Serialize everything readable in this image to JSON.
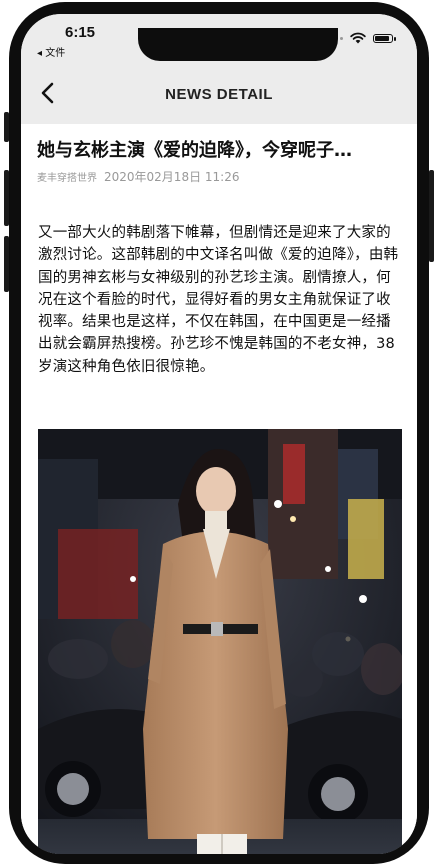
{
  "status_bar": {
    "time": "6:15",
    "back_app": "◂ 文件",
    "signal_icon": "signal-dots-icon",
    "wifi_icon": "wifi-icon",
    "battery_icon": "battery-icon",
    "battery_level": 0.85
  },
  "nav": {
    "title": "NEWS DETAIL",
    "back_icon": "chevron-left-icon"
  },
  "article": {
    "title": "她与玄彬主演《爱的迫降》，今穿呢子…",
    "source": "麦丰穿搭世界",
    "date": "2020年02月18日 11:26",
    "body": "又一部大火的韩剧落下帷幕，但剧情还是迎来了大家的激烈讨论。这部韩剧的中文译名叫做《爱的迫降》，由韩国的男神玄彬与女神级别的孙艺珍主演。剧情撩人，何况在这个看脸的时代，显得好看的男女主角就保证了收视率。结果也是这样，不仅在韩国，在中国更是一经播出就会霸屏热搜榜。孙艺珍不愧是韩国的不老女神，38岁演这种角色依旧很惊艳。"
  },
  "colors": {
    "header_bg": "#ececec",
    "device_frame": "#0d0d0d",
    "meta_text": "#999999"
  }
}
